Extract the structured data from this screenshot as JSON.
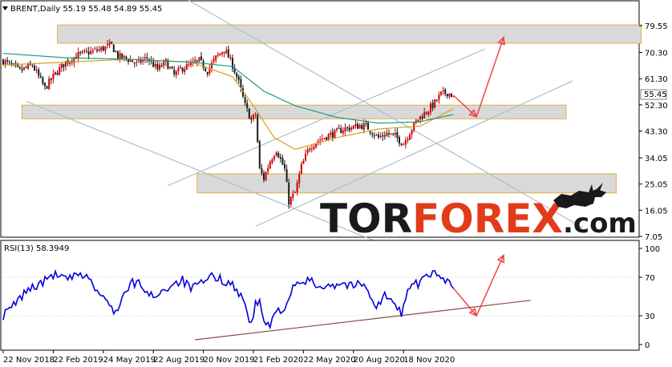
{
  "chart_data": [
    {
      "type": "candlestick",
      "symbol": "BRENT",
      "timeframe": "Daily",
      "header": "BRENT,Daily  55.19 55.48 54.89 55.45",
      "ohlc": {
        "open": 55.19,
        "high": 55.48,
        "low": 54.89,
        "close": 55.45
      },
      "last_price_label": "55.45",
      "y_ticks": [
        "79.55",
        "70.30",
        "61.30",
        "52.30",
        "43.30",
        "34.05",
        "25.05",
        "16.05",
        "7.05"
      ],
      "ylim": [
        7.05,
        79.55
      ],
      "price_path": [
        [
          0,
          67.5
        ],
        [
          8,
          64
        ],
        [
          14,
          66
        ],
        [
          20,
          58
        ],
        [
          25,
          63
        ],
        [
          30,
          67
        ],
        [
          36,
          69.5
        ],
        [
          42,
          70.5
        ],
        [
          47,
          71.5
        ],
        [
          52,
          72.8
        ],
        [
          55,
          69
        ],
        [
          60,
          68
        ],
        [
          64,
          66.5
        ],
        [
          69,
          68.5
        ],
        [
          74,
          64.5
        ],
        [
          78,
          67
        ],
        [
          82,
          62.5
        ],
        [
          86,
          65
        ],
        [
          90,
          66
        ],
        [
          94,
          67.5
        ],
        [
          98,
          64
        ],
        [
          102,
          68.5
        ],
        [
          106,
          71.5
        ],
        [
          110,
          66
        ],
        [
          113,
          60
        ],
        [
          116,
          52
        ],
        [
          119,
          47
        ],
        [
          121,
          49
        ],
        [
          123,
          30
        ],
        [
          125,
          27
        ],
        [
          128,
          33
        ],
        [
          131,
          37
        ],
        [
          135,
          30
        ],
        [
          137,
          19
        ],
        [
          140,
          22
        ],
        [
          143,
          31
        ],
        [
          147,
          38
        ],
        [
          151,
          40
        ],
        [
          155,
          41.5
        ],
        [
          159,
          42.5
        ],
        [
          163,
          44
        ],
        [
          167,
          44.5
        ],
        [
          171,
          45.2
        ],
        [
          174,
          45
        ],
        [
          177,
          43
        ],
        [
          180,
          41
        ],
        [
          184,
          42.5
        ],
        [
          188,
          41.5
        ],
        [
          192,
          39
        ],
        [
          195,
          43
        ],
        [
          199,
          47.5
        ],
        [
          203,
          50
        ],
        [
          207,
          53
        ],
        [
          210,
          56
        ],
        [
          213,
          56.5
        ],
        [
          216,
          55.45
        ]
      ],
      "moving_averages": [
        {
          "name": "fast",
          "color": "#d4a017",
          "values": [
            [
              0,
              66
            ],
            [
              30,
              67
            ],
            [
              60,
              68
            ],
            [
              90,
              67
            ],
            [
              110,
              62
            ],
            [
              120,
              52
            ],
            [
              130,
              41
            ],
            [
              140,
              37
            ],
            [
              160,
              41
            ],
            [
              180,
              44
            ],
            [
              200,
              45
            ],
            [
              216,
              51
            ]
          ]
        },
        {
          "name": "slow",
          "color": "#1a9e8a",
          "values": [
            [
              0,
              70
            ],
            [
              30,
              68.5
            ],
            [
              60,
              68
            ],
            [
              90,
              67
            ],
            [
              110,
              65.5
            ],
            [
              125,
              57
            ],
            [
              140,
              52
            ],
            [
              160,
              48
            ],
            [
              180,
              46
            ],
            [
              200,
              46.5
            ],
            [
              216,
              49
            ]
          ]
        }
      ],
      "zones": [
        {
          "from": 73.5,
          "to": 79.8,
          "x0": 26,
          "x1": 306
        },
        {
          "from": 47.5,
          "to": 52.2,
          "x0": 9,
          "x1": 270
        },
        {
          "from": 22.0,
          "to": 28.6,
          "x0": 93,
          "x1": 294
        }
      ],
      "trendlines": [
        {
          "p1": [
            75,
            94
          ],
          "p2": [
            278,
            10
          ]
        },
        {
          "p1": [
            79,
            24.5
          ],
          "p2": [
            231,
            71.5
          ]
        },
        {
          "p1": [
            121,
            10.5
          ],
          "p2": [
            273,
            60.5
          ]
        },
        {
          "p1": [
            11,
            53.5
          ],
          "p2": [
            187,
            3
          ]
        }
      ],
      "forecast_arrows": [
        [
          [
            216,
            55.5
          ],
          [
            227,
            48.2
          ]
        ],
        [
          [
            227,
            48.2
          ],
          [
            240,
            75.5
          ]
        ]
      ],
      "watermark": {
        "tor": "TOR",
        "forex": "FOREX",
        "com": ".com"
      }
    },
    {
      "type": "line",
      "indicator": "RSI(13)",
      "header": "RSI(13) 58.3949",
      "value": 58.3949,
      "y_ticks": [
        "100",
        "70",
        "30",
        "0"
      ],
      "ylim": [
        0,
        100
      ],
      "rsi_path": [
        [
          0,
          30
        ],
        [
          6,
          43
        ],
        [
          12,
          58
        ],
        [
          18,
          63
        ],
        [
          24,
          73
        ],
        [
          30,
          68
        ],
        [
          36,
          71
        ],
        [
          40,
          73
        ],
        [
          44,
          58
        ],
        [
          50,
          43
        ],
        [
          54,
          34
        ],
        [
          58,
          52
        ],
        [
          62,
          64
        ],
        [
          66,
          63
        ],
        [
          70,
          50
        ],
        [
          74,
          53
        ],
        [
          78,
          58
        ],
        [
          82,
          64
        ],
        [
          86,
          67
        ],
        [
          90,
          58
        ],
        [
          96,
          64
        ],
        [
          100,
          71
        ],
        [
          104,
          68
        ],
        [
          108,
          65
        ],
        [
          112,
          58
        ],
        [
          116,
          42
        ],
        [
          119,
          20
        ],
        [
          121,
          41
        ],
        [
          123,
          45
        ],
        [
          125,
          24
        ],
        [
          128,
          18
        ],
        [
          131,
          36
        ],
        [
          135,
          38
        ],
        [
          139,
          58
        ],
        [
          143,
          64
        ],
        [
          147,
          67
        ],
        [
          151,
          60
        ],
        [
          155,
          63
        ],
        [
          159,
          62
        ],
        [
          163,
          64
        ],
        [
          167,
          61
        ],
        [
          171,
          63
        ],
        [
          175,
          58
        ],
        [
          179,
          38
        ],
        [
          183,
          52
        ],
        [
          187,
          42
        ],
        [
          191,
          33
        ],
        [
          195,
          62
        ],
        [
          199,
          63
        ],
        [
          203,
          70
        ],
        [
          207,
          74
        ],
        [
          211,
          67
        ],
        [
          214,
          70
        ],
        [
          216,
          58.39
        ]
      ],
      "trendline": {
        "p1": [
          92,
          5
        ],
        "p2": [
          253,
          46
        ]
      },
      "forecast_arrows": [
        [
          [
            216,
            58.4
          ],
          [
            227,
            30
          ]
        ],
        [
          [
            227,
            30
          ],
          [
            240,
            93
          ]
        ]
      ],
      "x_ticks": [
        {
          "label": "22 Nov 2018",
          "i": 0
        },
        {
          "label": "22 Feb 2019",
          "i": 24
        },
        {
          "label": "24 May 2019",
          "i": 48
        },
        {
          "label": "22 Aug 2019",
          "i": 72
        },
        {
          "label": "20 Nov 2019",
          "i": 96
        },
        {
          "label": "21 Feb 2020",
          "i": 120
        },
        {
          "label": "22 May 2020",
          "i": 144
        },
        {
          "label": "20 Aug 2020",
          "i": 168
        },
        {
          "label": "18 Nov 2020",
          "i": 192
        }
      ]
    }
  ],
  "colors": {
    "bull": "#cc0000",
    "bear": "#1a1a1a",
    "rsi": "#0000dd",
    "zone_fill": "#d9d9d9",
    "zone_border": "#e0b040",
    "trend": "#a9bfd2",
    "rsi_trend": "#8b4a46",
    "arrow": "#ee4444",
    "axis": "#000000",
    "price_label_bg": "#ffffff"
  }
}
